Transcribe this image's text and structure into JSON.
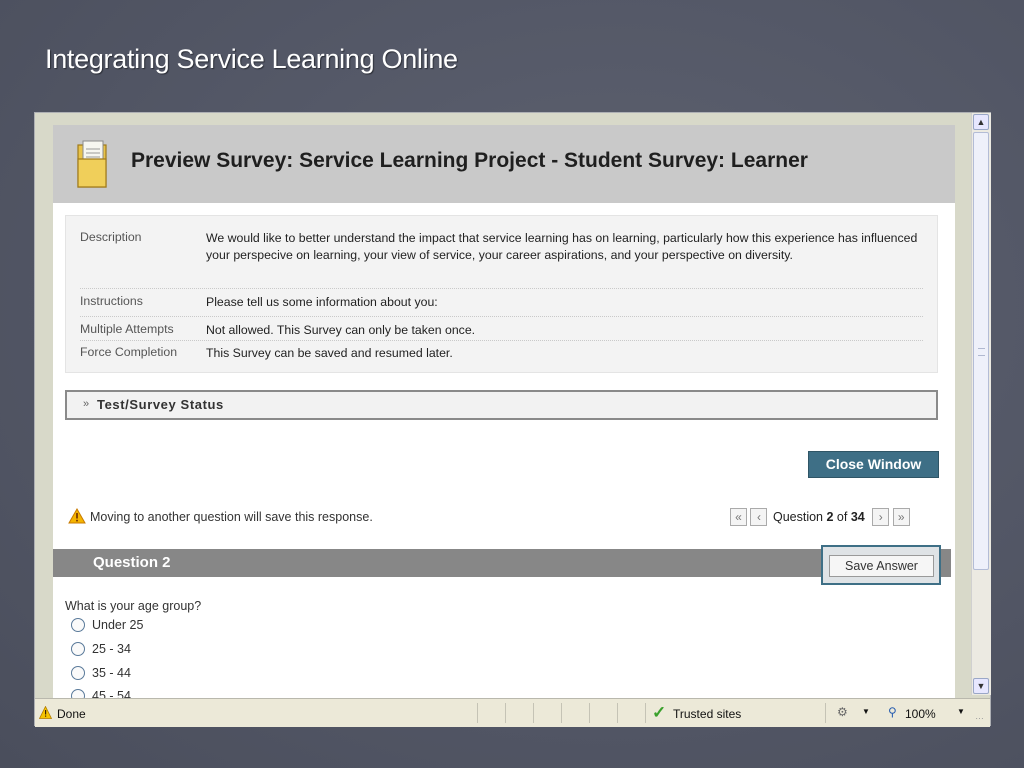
{
  "slide": {
    "title": "Integrating Service Learning Online"
  },
  "page": {
    "header_title": "Preview Survey: Service Learning Project - Student Survey: Learner",
    "info": [
      {
        "label": "Description",
        "value": "We would like to better understand the impact that service learning has on learning, particularly how this experience has influenced your perspecive on learning, your view of service, your career aspirations, and your perspective on diversity."
      },
      {
        "label": "Instructions",
        "value": "Please tell us some information about you:"
      },
      {
        "label": "Multiple Attempts",
        "value": "Not allowed. This Survey can only be taken once."
      },
      {
        "label": "Force Completion",
        "value": "This Survey can be saved and resumed later."
      }
    ],
    "status_section": "Test/Survey Status",
    "close_button": "Close Window",
    "warning": "Moving to another question will save this response.",
    "nav": {
      "prefix": "Question",
      "current": "2",
      "of": "of",
      "total": "34"
    },
    "question_label": "Question 2",
    "save_button": "Save Answer",
    "question_text": "What is your age group?",
    "options": [
      "Under 25",
      "25 - 34",
      "35 - 44",
      "45 - 54"
    ]
  },
  "browser_status": {
    "left_text": "Done",
    "zone": "Trusted sites",
    "zoom": "100%"
  },
  "icons": {
    "folder": "clipboard-folder-icon",
    "warning": "warning-triangle-icon",
    "check": "checkmark-icon",
    "zoom": "magnifier-icon"
  },
  "colors": {
    "accent": "#3e6f86",
    "question_bar": "#878787",
    "header_bg": "#c9c9c9"
  }
}
